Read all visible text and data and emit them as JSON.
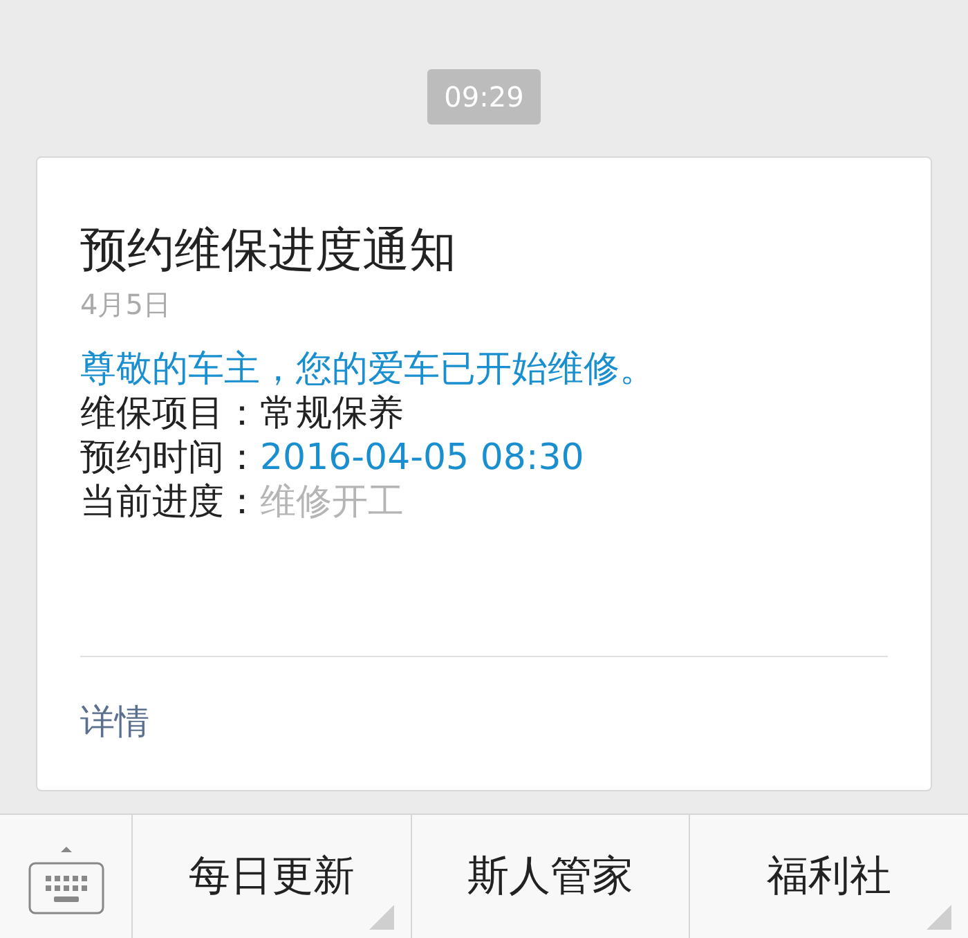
{
  "timestamp": "09:29",
  "card": {
    "title": "预约维保进度通知",
    "date": "4月5日",
    "lines": [
      {
        "kind": "notice",
        "text": "尊敬的车主，您的爱车已开始维修。"
      },
      {
        "kind": "field",
        "label": "维保项目：",
        "value": "常规保养",
        "color": "#222222"
      },
      {
        "kind": "field",
        "label": "预约时间：",
        "value": "2016-04-05 08:30",
        "color": "#1a8fd0"
      },
      {
        "kind": "field",
        "label": "当前进度：",
        "value": "维修开工",
        "color": "#b5b5b5"
      }
    ],
    "link": "详情"
  },
  "menu": [
    {
      "label": "每日更新",
      "has_submenu": true
    },
    {
      "label": "斯人管家",
      "has_submenu": false
    },
    {
      "label": "福利社",
      "has_submenu": true
    }
  ]
}
